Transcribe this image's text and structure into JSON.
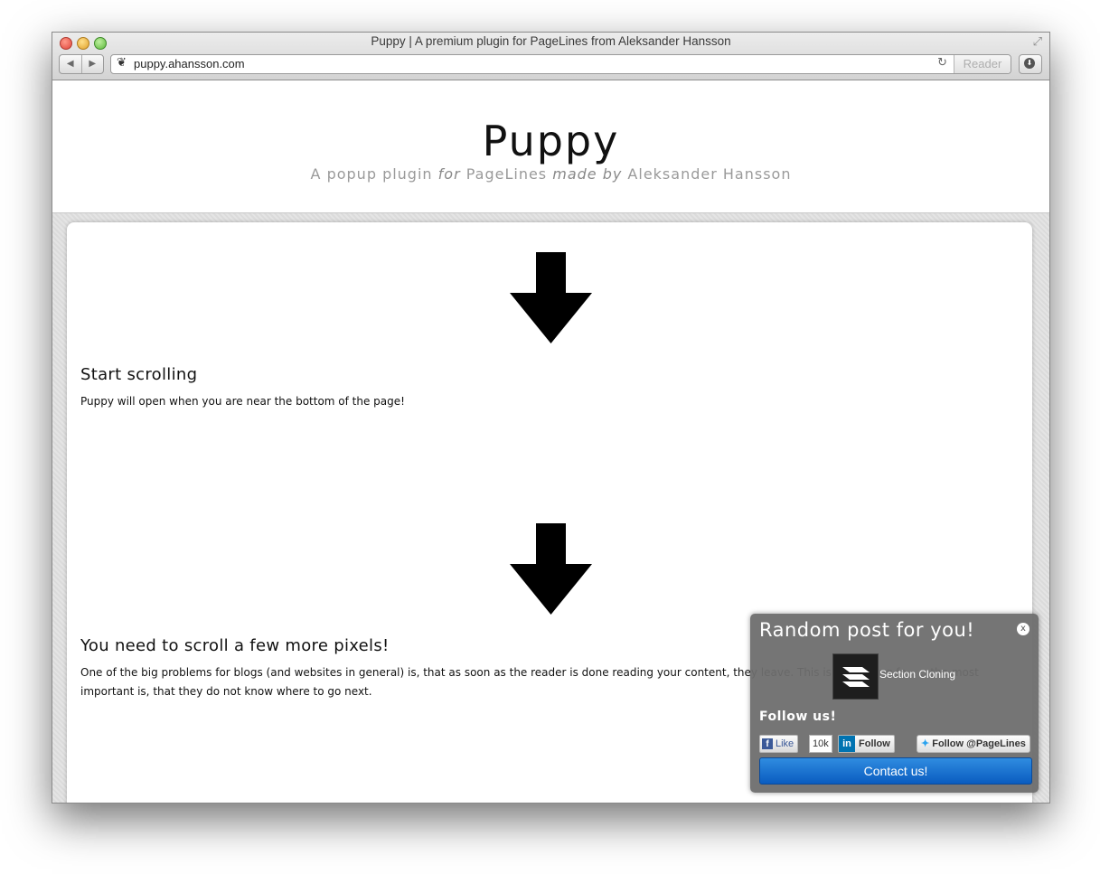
{
  "browser": {
    "window_title": "Puppy | A premium plugin for PageLines from Aleksander Hansson",
    "url": "puppy.ahansson.com",
    "reader_label": "Reader",
    "back_icon": "back-arrow-icon",
    "forward_icon": "forward-arrow-icon"
  },
  "header": {
    "title": "Puppy",
    "tagline_1": "A popup plugin ",
    "tagline_for": "for",
    "tagline_2": " PageLines ",
    "tagline_made_by": "made by",
    "tagline_3": " Aleksander Hansson"
  },
  "content": {
    "sections": [
      {
        "title": "Start scrolling",
        "text": "Puppy will open when you are near the bottom of the page!"
      },
      {
        "title": "You need to scroll a few more pixels!",
        "text": "One of the big problems for blogs (and websites in general) is, that as soon as the reader is done reading your content, they leave. This is happening fo... ...the most important is, that they do not know where to go next."
      }
    ]
  },
  "popup": {
    "title": "Random post for you!",
    "close_label": "x",
    "post_title": "Section Cloning",
    "follow_title": "Follow us!",
    "fb_like_label": "Like",
    "fb_count": "10k",
    "linkedin_label": "Follow",
    "twitter_label": "Follow @PageLines",
    "contact_label": "Contact us!"
  },
  "colors": {
    "accent_button": "#1a72d6",
    "popup_bg": "#6e6e6e"
  }
}
